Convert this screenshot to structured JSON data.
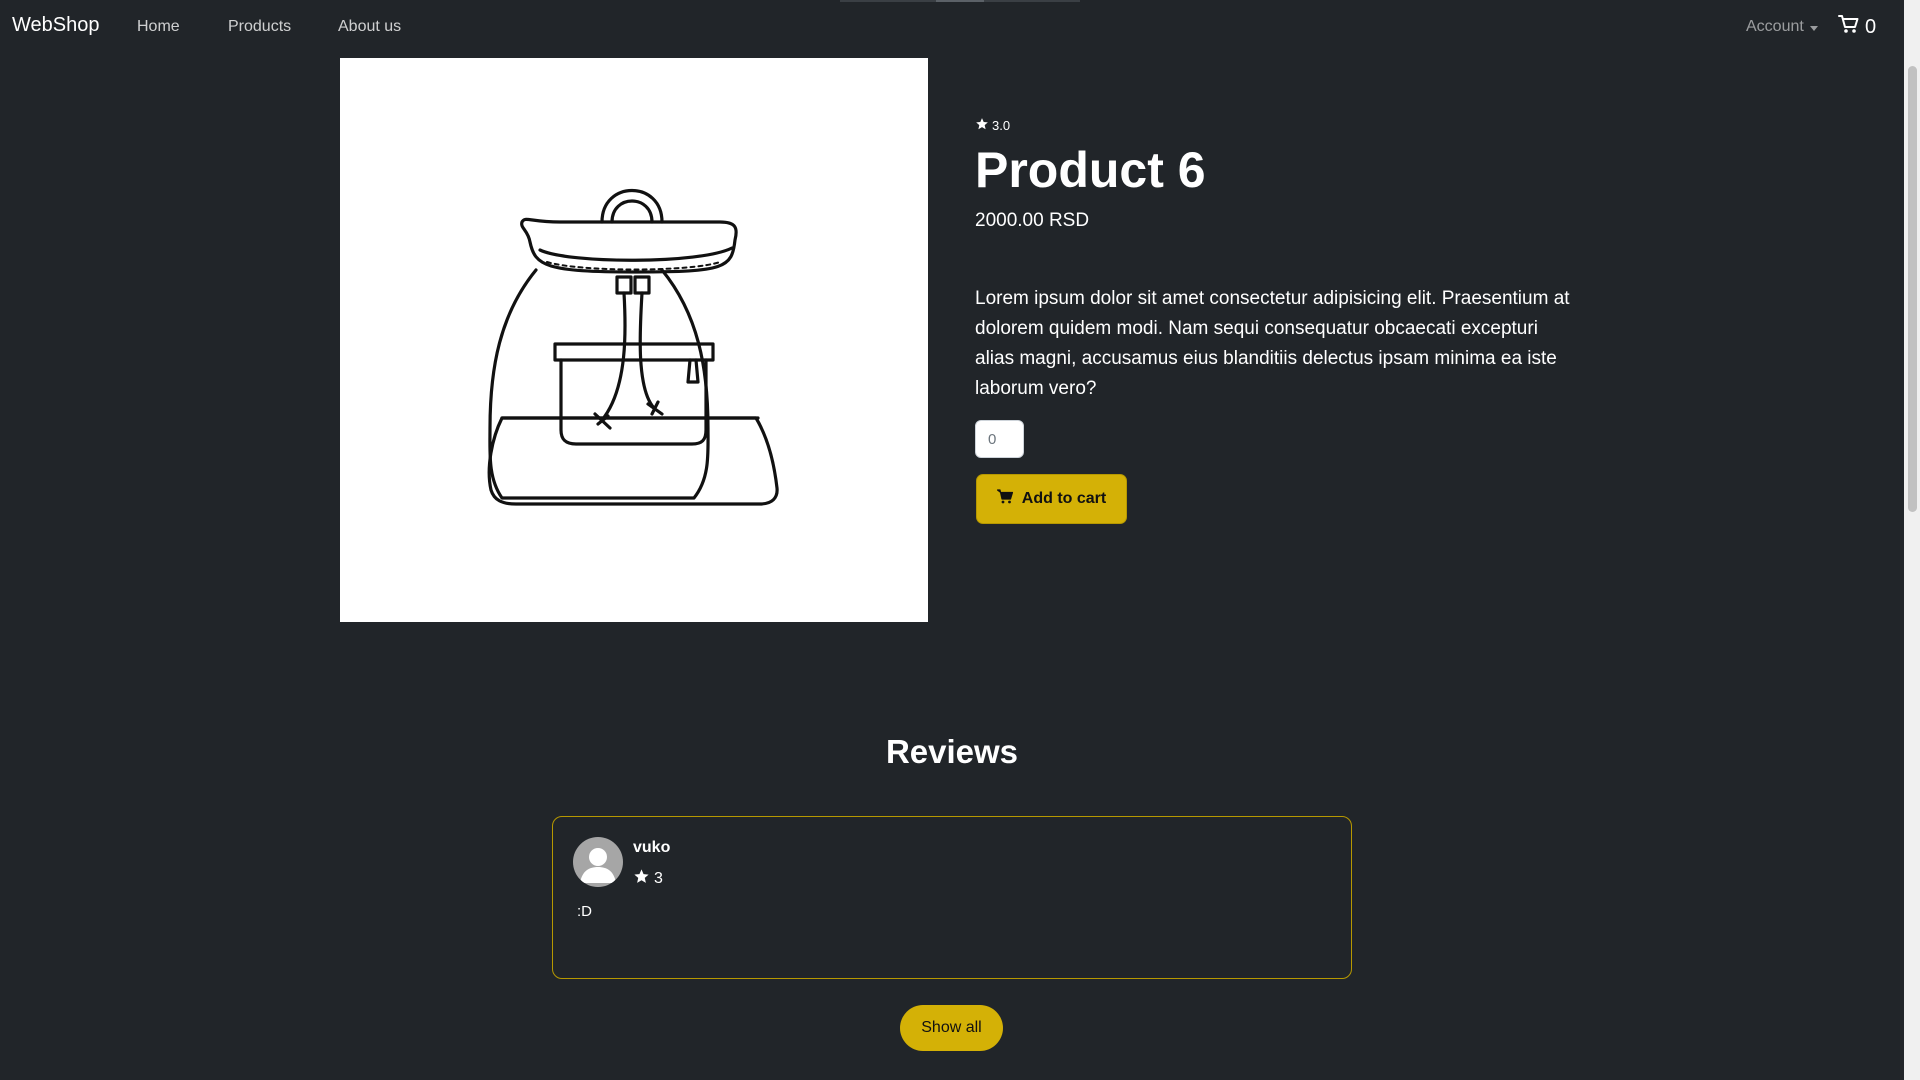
{
  "navbar": {
    "brand": "WebShop",
    "links": [
      "Home",
      "Products",
      "About us"
    ],
    "account_label": "Account",
    "cart_count": "0"
  },
  "product": {
    "rating": "3.0",
    "title": "Product 6",
    "price": "2000.00 RSD",
    "description": "Lorem ipsum dolor sit amet consectetur adipisicing elit. Praesentium at dolorem quidem modi. Nam sequi consequatur obcaecati excepturi alias magni, accusamus eius blanditiis delectus ipsam minima ea iste laborum vero?",
    "quantity": "0",
    "add_to_cart_label": "Add to cart",
    "image_icon": "backpack-illustration"
  },
  "reviews": {
    "heading": "Reviews",
    "items": [
      {
        "author": "vuko",
        "rating": "3",
        "text": ":D"
      }
    ],
    "show_all_label": "Show all"
  },
  "colors": {
    "background": "#212529",
    "accent": "#d4b106",
    "accent_border": "#b69800"
  }
}
